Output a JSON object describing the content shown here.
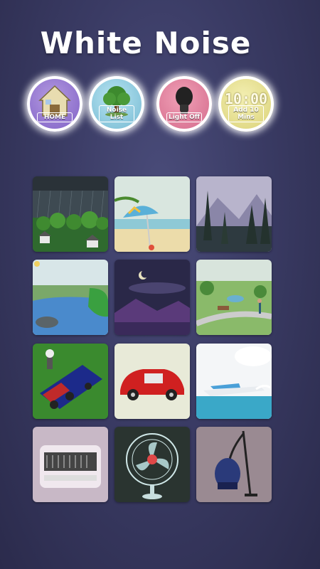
{
  "app": {
    "title": "White Noise"
  },
  "buttons": {
    "home": "HOME",
    "noise_list": "Noise List",
    "light_off": "Light Off",
    "timer_clock": "10:00",
    "timer_label": "Add 10 Mins"
  },
  "tiles": [
    "rain-storm",
    "beach",
    "forest-mountains",
    "river",
    "night-sky",
    "park",
    "train",
    "car",
    "boat",
    "radio",
    "fan",
    "vacuum-cleaner"
  ]
}
